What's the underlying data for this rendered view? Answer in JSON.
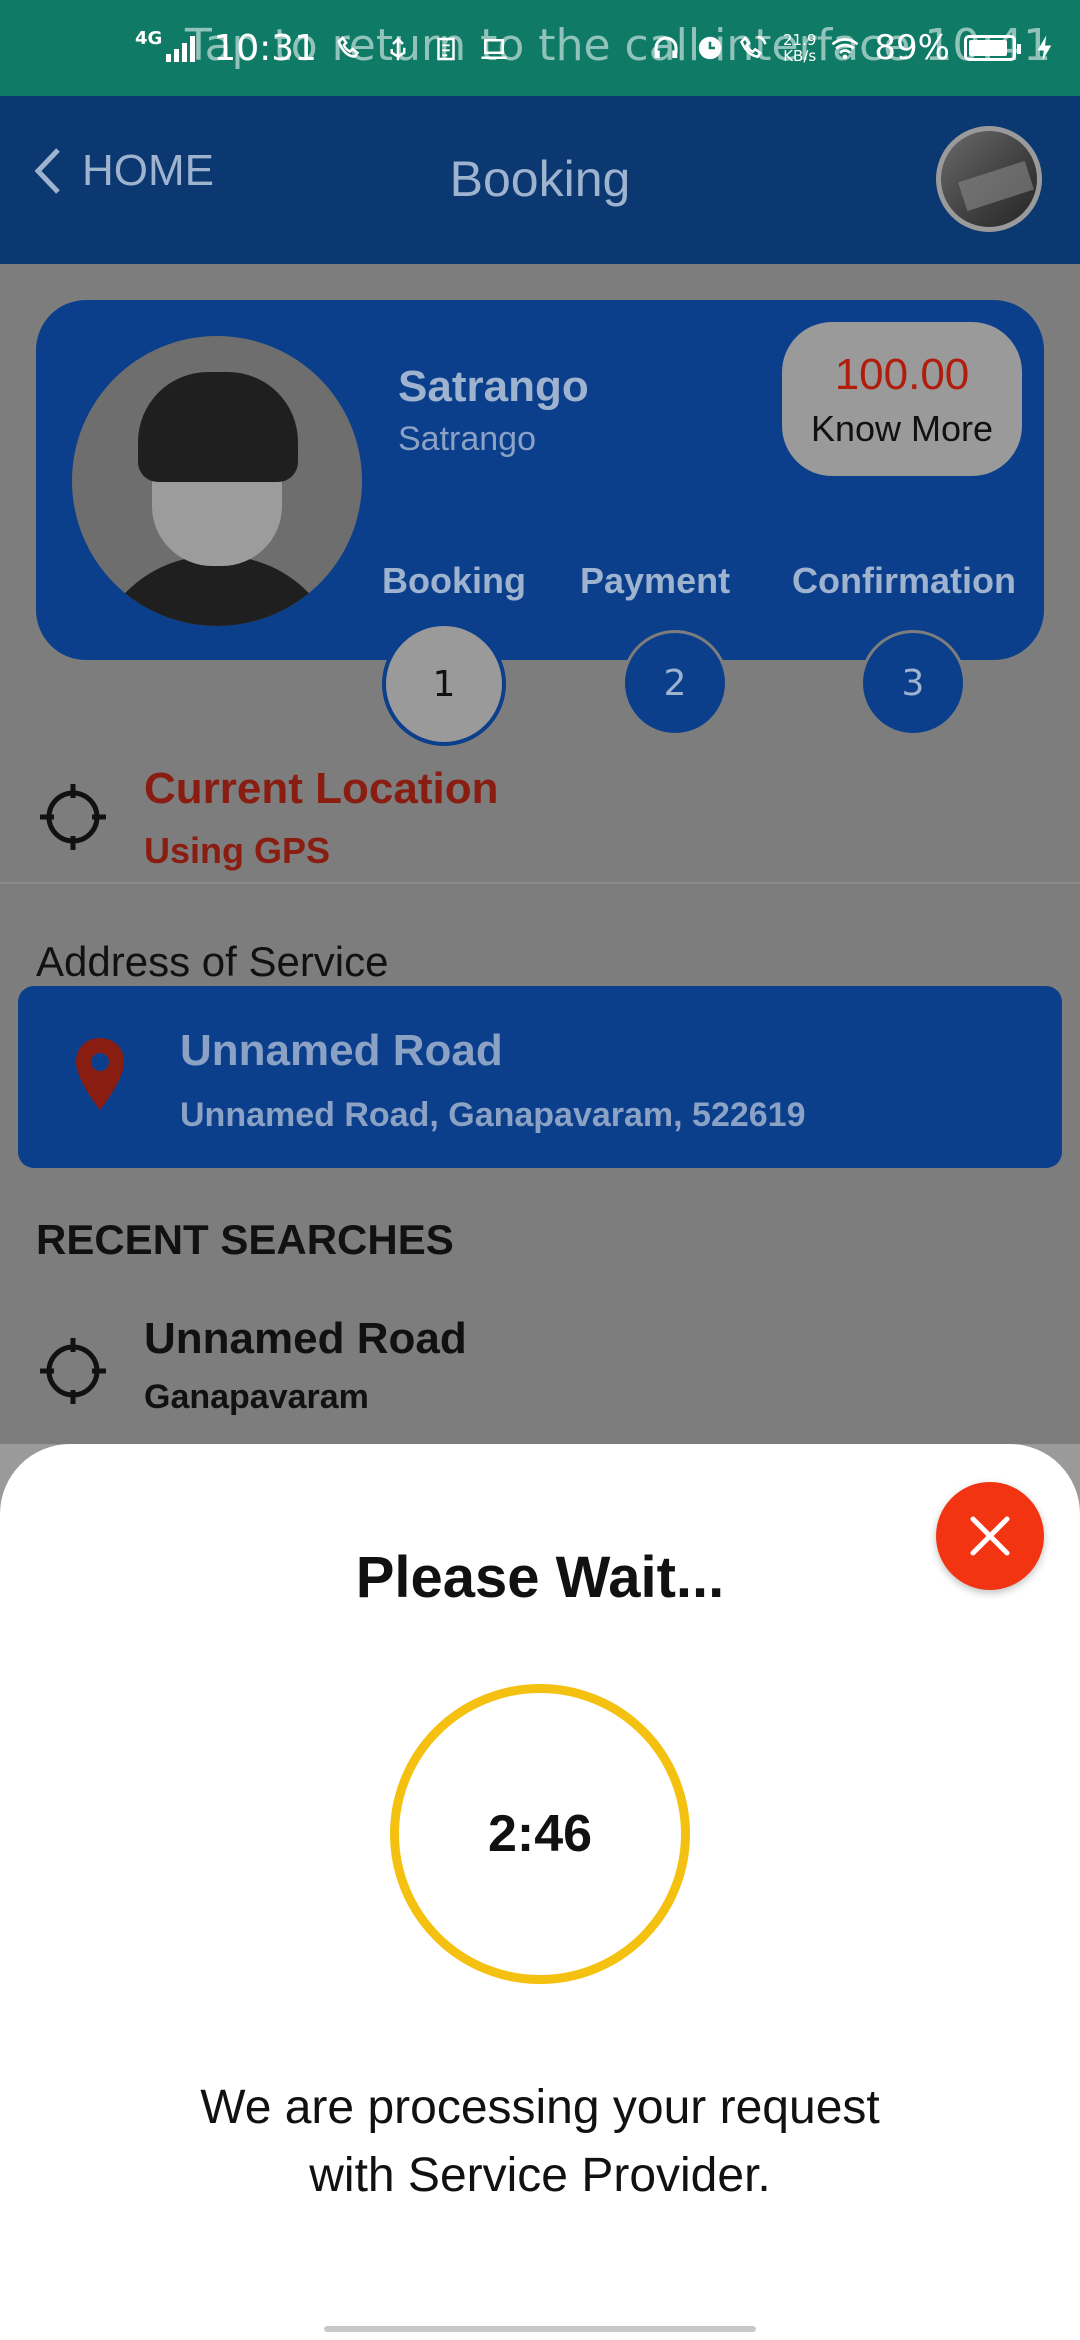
{
  "status_bar": {
    "network": "4G",
    "time": "10:31",
    "overlay_text": "Tap to return to the call interface  10:41",
    "speed_value": "21.9",
    "speed_unit": "KB/s",
    "battery": "89%"
  },
  "app_bar": {
    "back_label": "HOME",
    "title": "Booking"
  },
  "provider": {
    "name": "Satrango",
    "subtitle": "Satrango",
    "price": "100.00",
    "price_link": "Know More"
  },
  "steps": [
    {
      "label": "Booking",
      "number": "1",
      "active": true
    },
    {
      "label": "Payment",
      "number": "2",
      "active": false
    },
    {
      "label": "Confirmation",
      "number": "3",
      "active": false
    }
  ],
  "current_location": {
    "title": "Current Location",
    "subtitle": "Using GPS"
  },
  "address": {
    "section_label": "Address of Service",
    "title": "Unnamed Road",
    "detail": "Unnamed Road, Ganapavaram, 522619"
  },
  "recent": {
    "title": "RECENT SEARCHES",
    "items": [
      {
        "name": "Unnamed Road",
        "area": "Ganapavaram"
      }
    ]
  },
  "dialog": {
    "title": "Please Wait...",
    "timer": "2:46",
    "message_line1": "We are processing your request",
    "message_line2": "with Service Provider."
  },
  "colors": {
    "status_bar": "#0f7a66",
    "app_bar": "#0b3870",
    "card": "#0b3f8c",
    "close_button": "#f23413",
    "timer_ring": "#f5c111",
    "location_text": "#8a1d12"
  }
}
